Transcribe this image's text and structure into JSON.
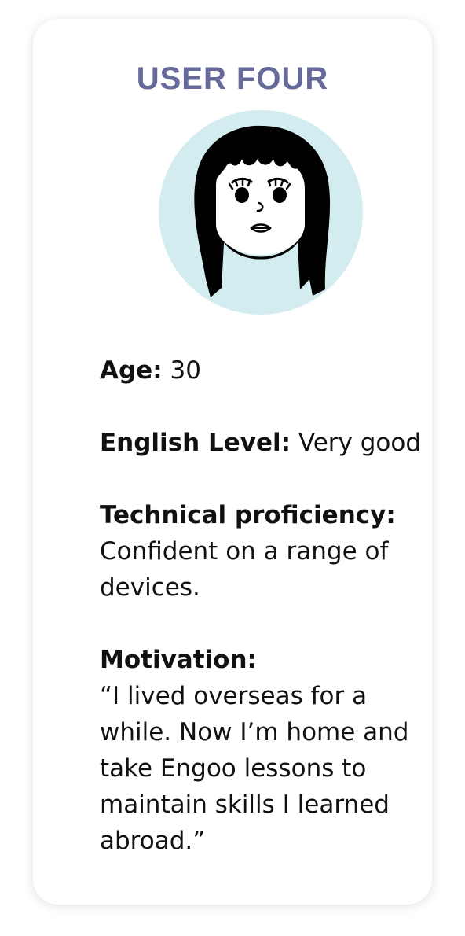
{
  "title": "USER FOUR",
  "colors": {
    "title": "#656a9a",
    "avatar_bg": "#d3ecef",
    "hair": "#000000",
    "skin": "#ffffff"
  },
  "avatar": {
    "icon": "woman-avatar-icon"
  },
  "fields": {
    "age": {
      "label": "Age:",
      "value": "30"
    },
    "english_level": {
      "label": "English Level:",
      "value": "Very good"
    },
    "technical_proficiency": {
      "label": "Technical proficiency:",
      "value": "Confident on a range of devices."
    },
    "motivation": {
      "label": "Motivation:",
      "value": "“I lived overseas for a while. Now I’m home and take Engoo lessons to maintain skills I learned abroad.”"
    }
  }
}
